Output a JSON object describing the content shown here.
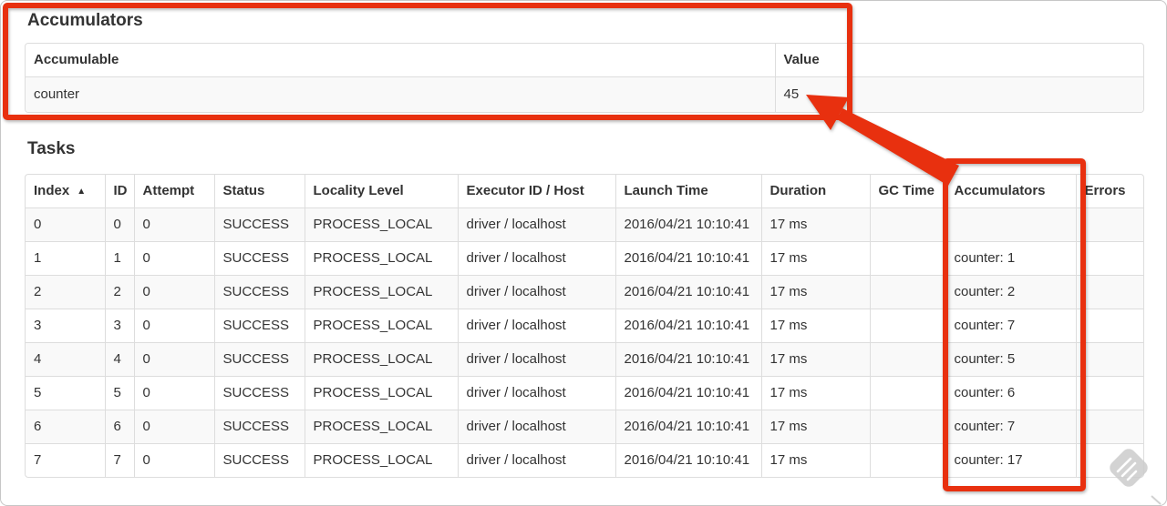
{
  "accumulators_section": {
    "title": "Accumulators",
    "table": {
      "headers": [
        "Accumulable",
        "Value"
      ],
      "rows": [
        {
          "name": "counter",
          "value": "45"
        }
      ]
    }
  },
  "tasks_section": {
    "title": "Tasks",
    "table": {
      "headers": [
        "Index",
        "ID",
        "Attempt",
        "Status",
        "Locality Level",
        "Executor ID / Host",
        "Launch Time",
        "Duration",
        "GC Time",
        "Accumulators",
        "Errors"
      ],
      "sort": {
        "column": "Index",
        "direction": "ascending",
        "icon": "▲"
      },
      "rows": [
        [
          "0",
          "0",
          "0",
          "SUCCESS",
          "PROCESS_LOCAL",
          "driver / localhost",
          "2016/04/21 10:10:41",
          "17 ms",
          "",
          "",
          ""
        ],
        [
          "1",
          "1",
          "0",
          "SUCCESS",
          "PROCESS_LOCAL",
          "driver / localhost",
          "2016/04/21 10:10:41",
          "17 ms",
          "",
          "counter: 1",
          ""
        ],
        [
          "2",
          "2",
          "0",
          "SUCCESS",
          "PROCESS_LOCAL",
          "driver / localhost",
          "2016/04/21 10:10:41",
          "17 ms",
          "",
          "counter: 2",
          ""
        ],
        [
          "3",
          "3",
          "0",
          "SUCCESS",
          "PROCESS_LOCAL",
          "driver / localhost",
          "2016/04/21 10:10:41",
          "17 ms",
          "",
          "counter: 7",
          ""
        ],
        [
          "4",
          "4",
          "0",
          "SUCCESS",
          "PROCESS_LOCAL",
          "driver / localhost",
          "2016/04/21 10:10:41",
          "17 ms",
          "",
          "counter: 5",
          ""
        ],
        [
          "5",
          "5",
          "0",
          "SUCCESS",
          "PROCESS_LOCAL",
          "driver / localhost",
          "2016/04/21 10:10:41",
          "17 ms",
          "",
          "counter: 6",
          ""
        ],
        [
          "6",
          "6",
          "0",
          "SUCCESS",
          "PROCESS_LOCAL",
          "driver / localhost",
          "2016/04/21 10:10:41",
          "17 ms",
          "",
          "counter: 7",
          ""
        ],
        [
          "7",
          "7",
          "0",
          "SUCCESS",
          "PROCESS_LOCAL",
          "driver / localhost",
          "2016/04/21 10:10:41",
          "17 ms",
          "",
          "counter: 17",
          ""
        ]
      ]
    }
  },
  "annotations": {
    "highlight_color": "#e8300f",
    "boxes": [
      "accumulators-summary-table",
      "tasks-accumulators-column"
    ],
    "arrow_target_value": "45"
  },
  "colors": {
    "table_border": "#dddddd",
    "row_stripe": "#f9f9f9",
    "text": "#333333",
    "frame_border": "#c6c6c6",
    "watermark": "#cccccc"
  }
}
